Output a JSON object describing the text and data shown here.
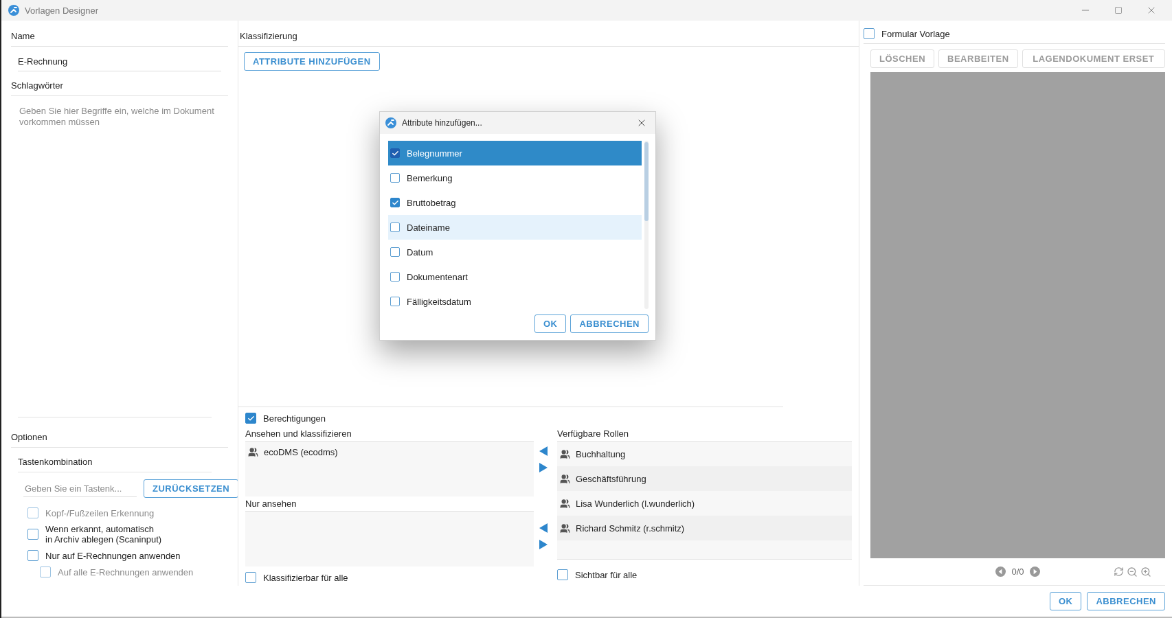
{
  "window": {
    "title": "Vorlagen Designer"
  },
  "name": {
    "label": "Name",
    "value": "E-Rechnung"
  },
  "keywords": {
    "label": "Schlagwörter",
    "placeholder": "Geben Sie hier Begriffe ein, welche im Dokument vorkommen müssen"
  },
  "options": {
    "label": "Optionen",
    "shortcut_label": "Tastenkombination",
    "shortcut_placeholder": "Geben Sie ein Tastenk...",
    "reset_button": "ZURÜCKSETZEN",
    "checkboxes": [
      {
        "label": "Kopf-/Fußzeilen Erkennung",
        "checked": false,
        "disabled": true
      },
      {
        "label": "Wenn erkannt, automatisch\nin Archiv ablegen (Scaninput)",
        "checked": false,
        "disabled": false
      },
      {
        "label": "Nur auf E-Rechnungen anwenden",
        "checked": false,
        "disabled": false,
        "children": [
          {
            "label": "Auf alle E-Rechnungen anwenden",
            "checked": false,
            "disabled": true
          }
        ]
      }
    ]
  },
  "classification": {
    "label": "Klassifizierung",
    "add_button": "ATTRIBUTE HINZUFÜGEN"
  },
  "permissions": {
    "label": "Berechtigungen",
    "checked": true,
    "view_classify": {
      "label": "Ansehen und klassifizieren",
      "items": [
        "ecoDMS (ecodms)"
      ]
    },
    "view_only": {
      "label": "Nur ansehen"
    },
    "classify_all": {
      "label": "Klassifizierbar für alle",
      "checked": false
    },
    "available_roles": {
      "label": "Verfügbare Rollen",
      "items": [
        "Buchhaltung",
        "Geschäftsführung",
        "Lisa Wunderlich (l.wunderlich)",
        "Richard Schmitz (r.schmitz)"
      ]
    },
    "visible_all": {
      "label": "Sichtbar für alle",
      "checked": false
    }
  },
  "form_template": {
    "label": "Formular Vorlage",
    "checked": false,
    "buttons": [
      {
        "label": "LÖSCHEN",
        "disabled": true
      },
      {
        "label": "BEARBEITEN",
        "disabled": true
      },
      {
        "label": "LAGENDOKUMENT ERSET",
        "disabled": true
      }
    ],
    "page_indicator": "0/0"
  },
  "footer_buttons": [
    "OK",
    "ABBRECHEN"
  ],
  "dialog": {
    "title": "Attribute hinzufügen...",
    "items": [
      {
        "label": "Belegnummer",
        "checked": true,
        "selected": true,
        "hovered": false
      },
      {
        "label": "Bemerkung",
        "checked": false,
        "selected": false,
        "hovered": false
      },
      {
        "label": "Bruttobetrag",
        "checked": true,
        "selected": false,
        "hovered": false
      },
      {
        "label": "Dateiname",
        "checked": false,
        "selected": false,
        "hovered": true
      },
      {
        "label": "Datum",
        "checked": false,
        "selected": false,
        "hovered": false
      },
      {
        "label": "Dokumentenart",
        "checked": false,
        "selected": false,
        "hovered": false
      },
      {
        "label": "Fälligkeitsdatum",
        "checked": false,
        "selected": false,
        "hovered": false
      }
    ],
    "buttons": [
      "OK",
      "ABBRECHEN"
    ]
  }
}
